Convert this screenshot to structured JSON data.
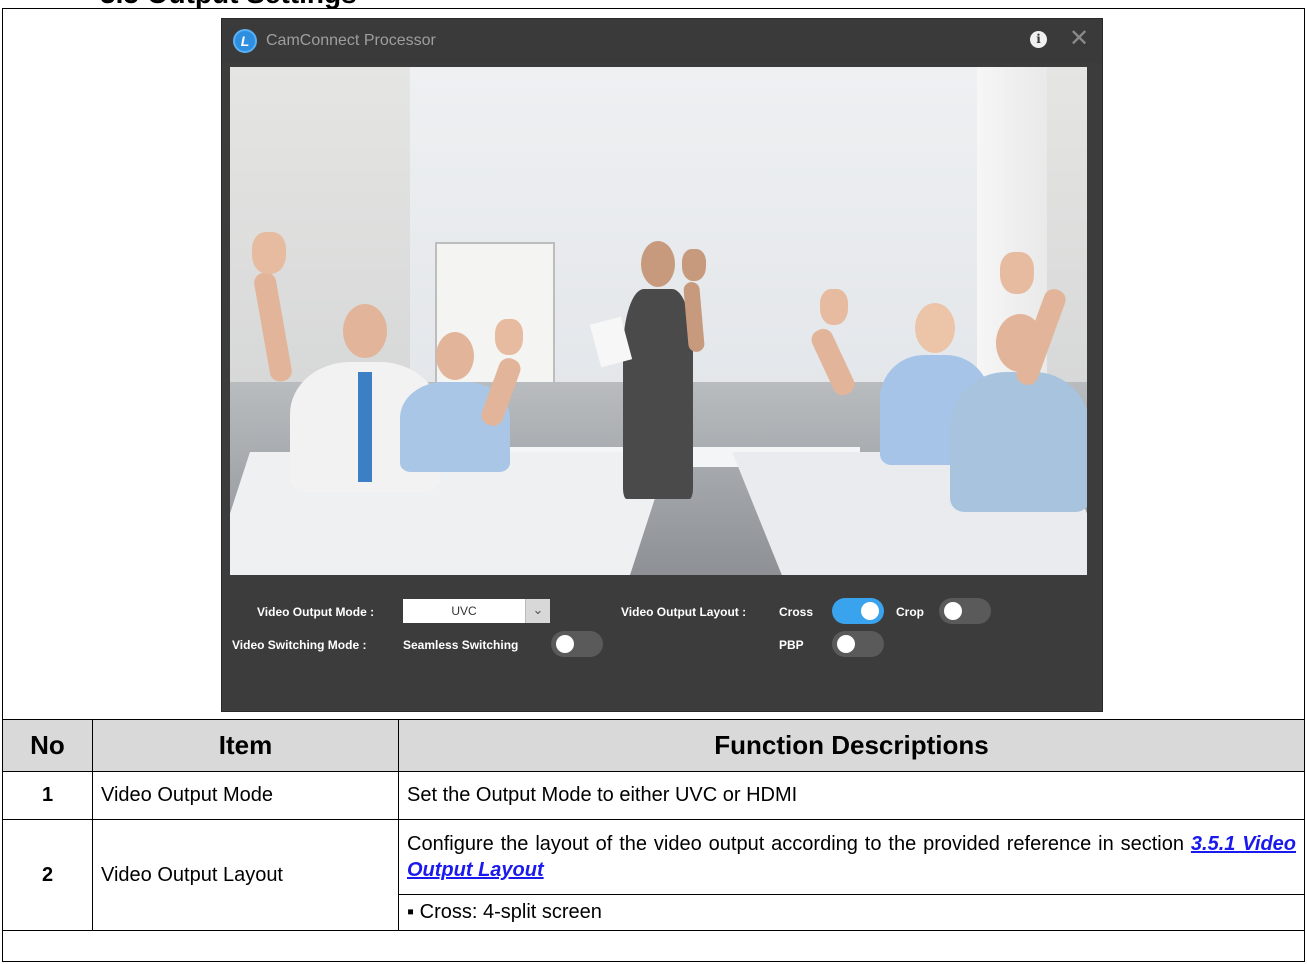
{
  "app": {
    "title": "CamConnect Processor",
    "logo_letter": "L",
    "info_icon": "i",
    "close_icon": "✕"
  },
  "controls": {
    "video_output_mode_label": "Video Output Mode :",
    "video_output_mode_value": "UVC",
    "video_switching_mode_label": "Video Switching Mode :",
    "seamless_switching_label": "Seamless Switching",
    "seamless_switching_on": false,
    "video_output_layout_label": "Video Output Layout :",
    "layouts": [
      {
        "label": "Cross",
        "on": true
      },
      {
        "label": "Crop",
        "on": false
      },
      {
        "label": "PBP",
        "on": false
      }
    ],
    "accent_color": "#3aa3ee"
  },
  "table": {
    "headers": [
      "No",
      "Item",
      "Function Descriptions"
    ],
    "rows": [
      {
        "no": "1",
        "item": "Video Output Mode",
        "description": "Set the Output Mode to either UVC or HDMI"
      },
      {
        "no": "2",
        "item": "Video Output Layout",
        "description_prefix": "Configure the layout of the video output according to the provided reference in section ",
        "description_link": "3.5.1 Video Output Layout",
        "bullet": "▪ Cross: 4-split screen"
      }
    ]
  }
}
